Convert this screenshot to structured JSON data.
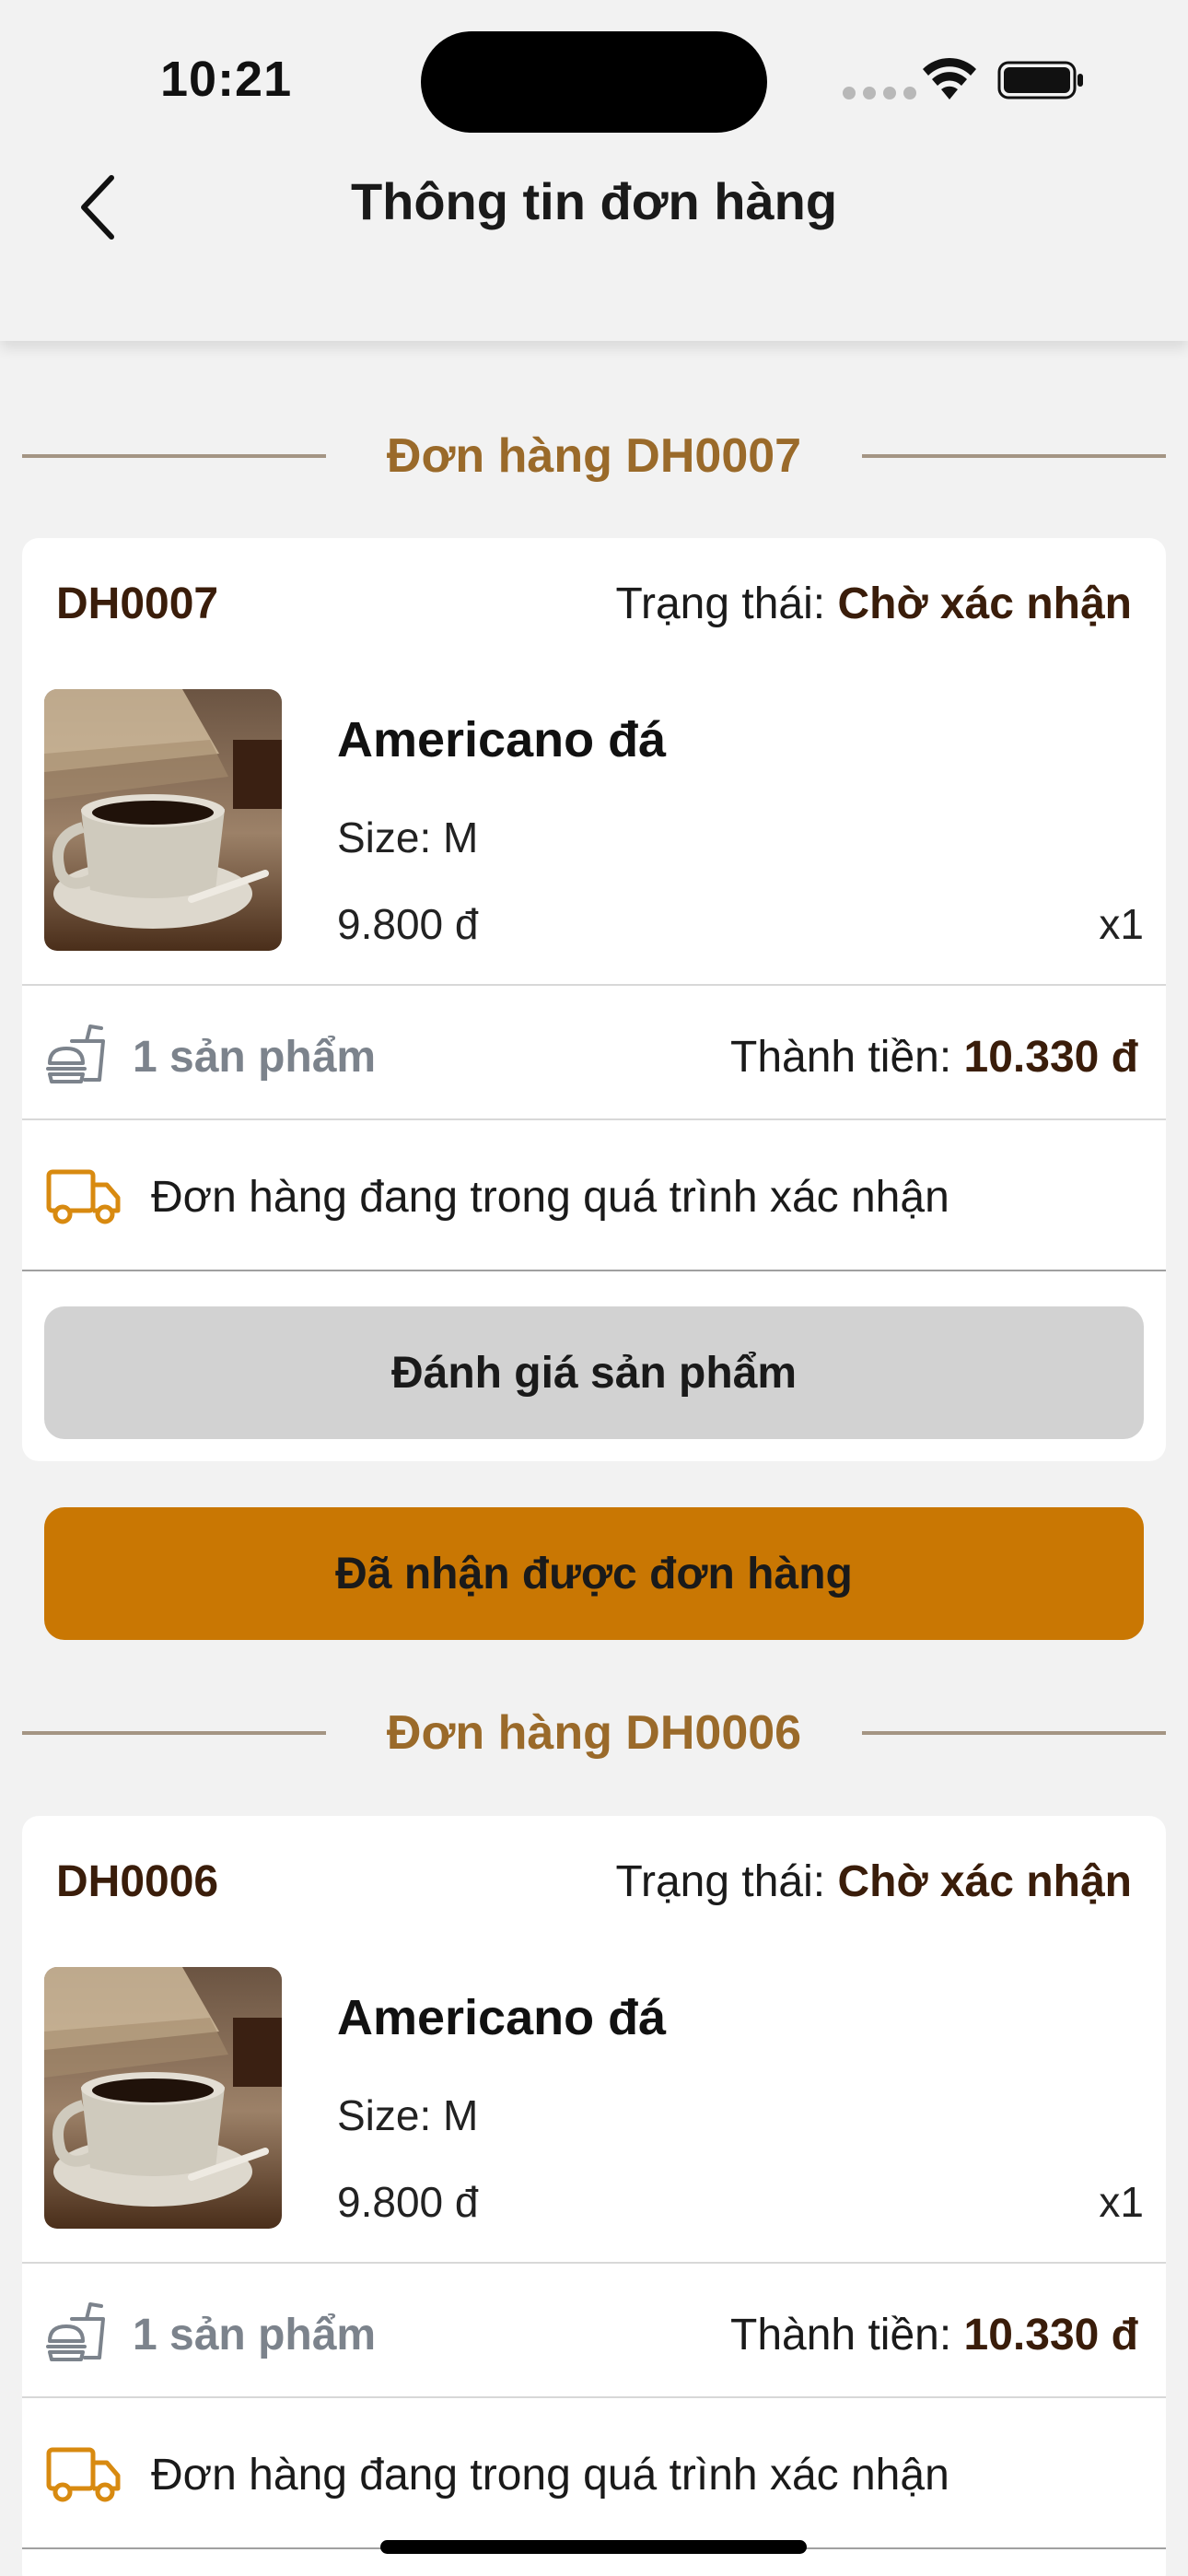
{
  "status_bar": {
    "time": "10:21"
  },
  "header": {
    "title": "Thông tin đơn hàng"
  },
  "orders": [
    {
      "section_title": "Đơn hàng DH0007",
      "id": "DH0007",
      "status_label": "Trạng thái:",
      "status_value": "Chờ xác nhận",
      "product": {
        "name": "Americano đá",
        "size": "Size: M",
        "price": "9.800 đ",
        "qty": "x1"
      },
      "item_count": "1 sản phẩm",
      "total_label": "Thành tiền:",
      "total_value": "10.330 đ",
      "delivery_text": "Đơn hàng đang trong quá trình xác nhận",
      "review_label": "Đánh giá sản phẩm",
      "received_label": "Đã nhận được đơn hàng"
    },
    {
      "section_title": "Đơn hàng DH0006",
      "id": "DH0006",
      "status_label": "Trạng thái:",
      "status_value": "Chờ xác nhận",
      "product": {
        "name": "Americano đá",
        "size": "Size: M",
        "price": "9.800 đ",
        "qty": "x1"
      },
      "item_count": "1 sản phẩm",
      "total_label": "Thành tiền:",
      "total_value": "10.330 đ",
      "delivery_text": "Đơn hàng đang trong quá trình xác nhận"
    }
  ],
  "colors": {
    "accent": "#c97703",
    "brown_dark": "#3a1d0a",
    "section_title": "#9a6a2a",
    "divider": "#a49584",
    "muted": "#7c838c",
    "review_button": "#d2d2d2"
  },
  "icons": {
    "back": "chevron-left-icon",
    "food": "fastfood-icon",
    "truck": "delivery-truck-icon"
  }
}
